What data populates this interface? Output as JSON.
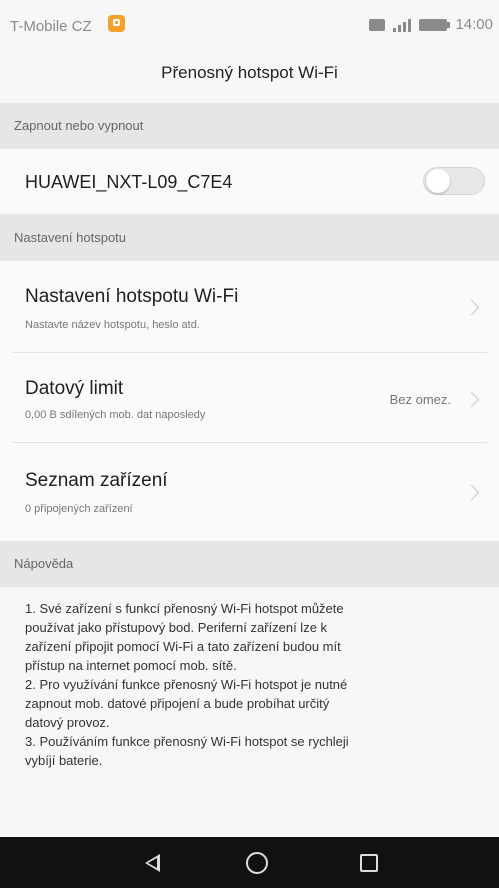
{
  "status_bar": {
    "carrier": "T-Mobile CZ",
    "time": "14:00",
    "icons": [
      "notification-icon",
      "screen-icon",
      "signal-icon",
      "battery-icon"
    ]
  },
  "app_bar": {
    "title": "Přenosný hotspot Wi-Fi"
  },
  "sections": {
    "toggle_header": "Zapnout nebo vypnout",
    "settings_header": "Nastavení hotspotu",
    "help_header": "Nápověda"
  },
  "hotspot": {
    "ssid": "HUAWEI_NXT-L09_C7E4",
    "enabled": false
  },
  "settings": {
    "wifi_settings": {
      "title": "Nastavení hotspotu Wi-Fi",
      "subtitle": "Nastavte název hotspotu, heslo atd."
    },
    "data_limit": {
      "title": "Datový limit",
      "subtitle": "0,00 B sdílených mob. dat naposledy",
      "value": "Bez omez."
    },
    "device_list": {
      "title": "Seznam zařízení",
      "subtitle": "0 připojených zařízení"
    }
  },
  "help": {
    "lines": [
      "1. Své zařízení s funkcí přenosný Wi-Fi hotspot můžete",
      "používat jako přístupový bod. Periferní zařízení lze k",
      "zařízení připojit pomocí Wi-Fi a tato zařízení budou mít",
      "přístup na internet pomocí mob. sítě.",
      "2. Pro využívání funkce přenosný Wi-Fi hotspot je nutné",
      "zapnout mob. datové připojení a bude probíhat určitý",
      "datový provoz.",
      "3. Používáním funkce přenosný Wi-Fi hotspot se rychleji",
      "vybíjí baterie."
    ]
  },
  "nav_bar": {
    "buttons": [
      "back-icon",
      "home-icon",
      "recents-icon"
    ]
  },
  "colors": {
    "background": "#f7f7f7",
    "section_header": "#e6e6e6",
    "nav_bar": "#111111",
    "notification_accent": "#f4a12a"
  }
}
